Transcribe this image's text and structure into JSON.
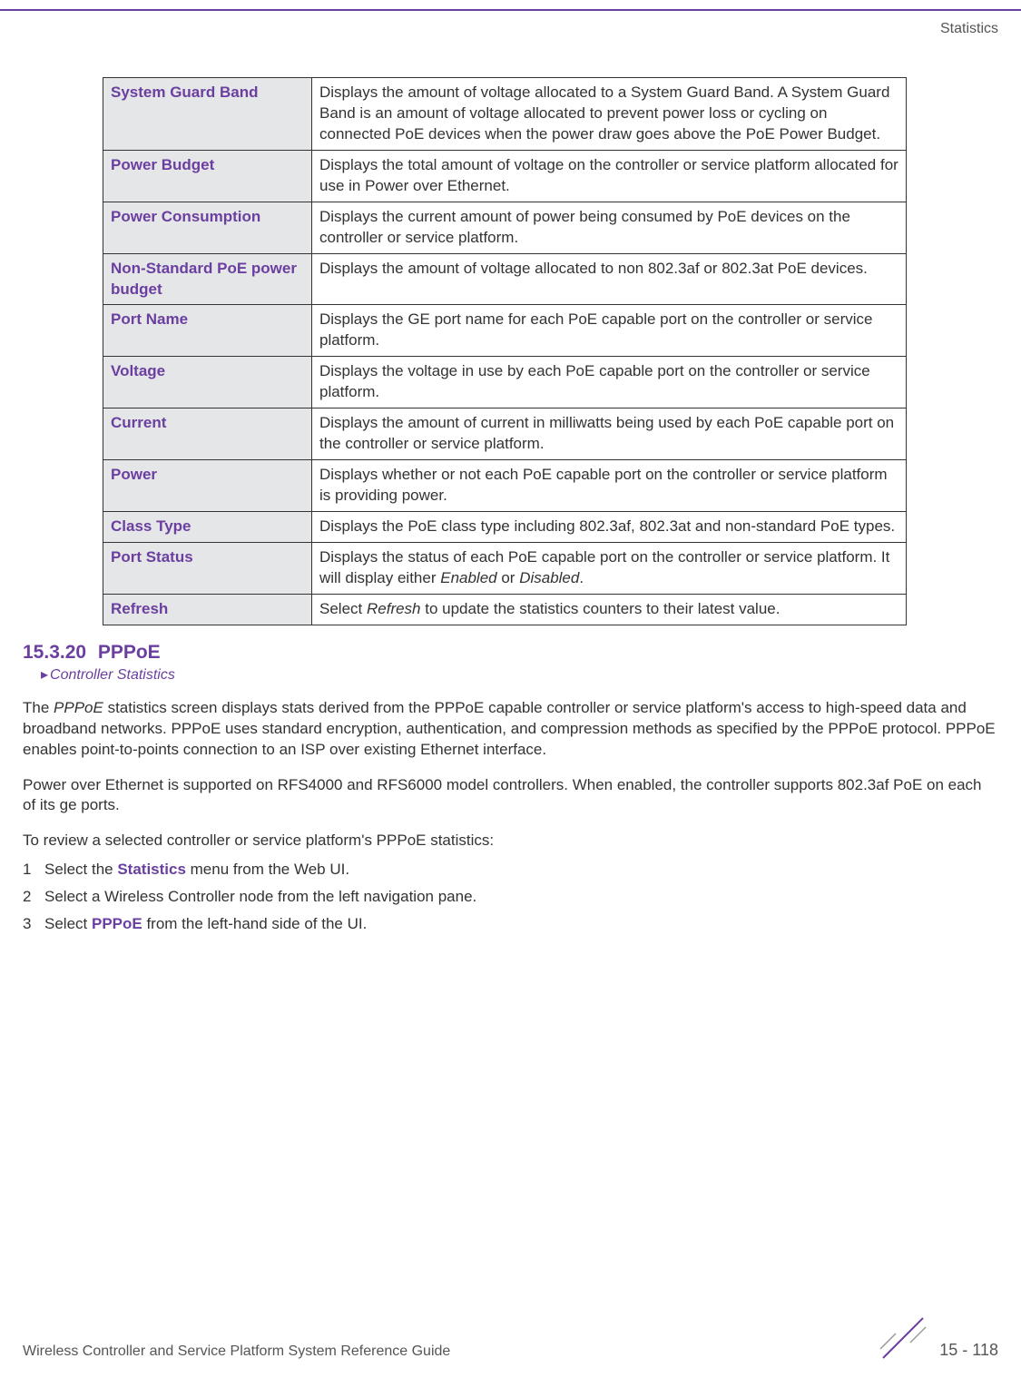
{
  "header": {
    "section": "Statistics"
  },
  "table": {
    "rows": [
      {
        "label": "System Guard Band",
        "desc": "Displays the amount of voltage allocated to a System Guard Band. A System Guard Band is an amount of voltage allocated to prevent power loss or cycling on connected PoE devices when the power draw goes above the PoE Power Budget."
      },
      {
        "label": "Power Budget",
        "desc": "Displays the total amount of voltage on the controller or service platform allocated for use in Power over Ethernet."
      },
      {
        "label": "Power Consumption",
        "desc": "Displays the current amount of power being consumed by PoE devices on the controller or service platform."
      },
      {
        "label": "Non-Standard PoE power budget",
        "desc": "Displays the amount of voltage allocated to non 802.3af or 802.3at PoE devices."
      },
      {
        "label": "Port Name",
        "desc": "Displays the GE port name for each PoE capable port on the controller or service platform."
      },
      {
        "label": "Voltage",
        "desc": "Displays the voltage in use by each PoE capable port on the controller or service platform."
      },
      {
        "label": "Current",
        "desc": "Displays the amount of current in milliwatts being used by each PoE capable port on the controller or service platform."
      },
      {
        "label": "Power",
        "desc": "Displays whether or not each PoE capable port on the controller or service platform is providing power."
      },
      {
        "label": "Class Type",
        "desc": "Displays the PoE class type including 802.3af, 802.3at and non-standard PoE types."
      },
      {
        "label": "Port Status",
        "desc_html": "Displays the status of each PoE capable port on the controller or service platform. It will display either <span class=\"italic\">Enabled</span> or <span class=\"italic\">Disabled</span>."
      },
      {
        "label": "Refresh",
        "desc_html": "Select <span class=\"italic\">Refresh</span> to update the statistics counters to their latest value."
      }
    ]
  },
  "section": {
    "number": "15.3.20",
    "title": "PPPoE",
    "breadcrumb": "Controller Statistics"
  },
  "paragraphs": {
    "p1_html": "The <span class=\"pppoe-italic\">PPPoE</span> statistics screen displays stats derived from the PPPoE capable controller or service platform's access to high-speed data and broadband networks. PPPoE uses standard encryption, authentication, and compression methods as specified by the PPPoE protocol. PPPoE enables point-to-points connection to an ISP over existing Ethernet interface.",
    "p2": "Power over Ethernet is supported on RFS4000 and RFS6000 model controllers. When enabled, the controller supports 802.3af PoE on each of its ge ports.",
    "p3": "To review a selected controller or service platform's PPPoE statistics:"
  },
  "steps": [
    {
      "num": "1",
      "html": "Select the <span class=\"bold-purple\">Statistics</span> menu from the Web UI."
    },
    {
      "num": "2",
      "html": "Select a Wireless Controller node from the left navigation pane."
    },
    {
      "num": "3",
      "html": "Select <span class=\"bold-purple\">PPPoE</span> from the left-hand side of the UI."
    }
  ],
  "footer": {
    "guide": "Wireless Controller and Service Platform System Reference Guide",
    "page": "15 - 118"
  }
}
